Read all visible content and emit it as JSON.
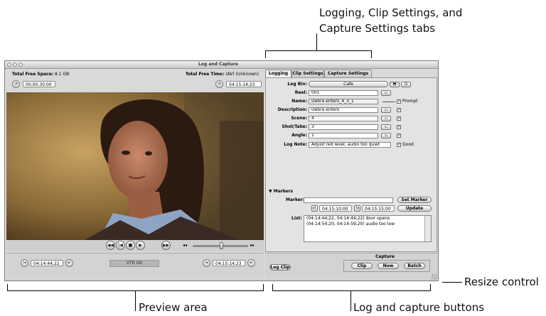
{
  "callouts": {
    "tabs_line1": "Logging, Clip Settings, and",
    "tabs_line2": "Capture Settings tabs",
    "resize": "Resize control",
    "preview": "Preview area",
    "log_capture": "Log and capture buttons"
  },
  "window": {
    "title": "Log and Capture",
    "total_free_space_label": "Total Free Space:",
    "total_free_space_value": "8.1 GB",
    "total_free_time_label": "Total Free Time:",
    "total_free_time_value": "(AV) (Unknown)",
    "duration_tc": "00:00:30;00",
    "current_tc": "04:15:14;23"
  },
  "transport": {
    "rewind": "◀◀",
    "prev": "|◀",
    "stop": "■",
    "play": "▶",
    "ffwd": "▶▶"
  },
  "bottom_left": {
    "in_tc": "04:14:44;22",
    "vtr_status": "VTR OK",
    "out_tc": "04:15:14;23"
  },
  "tabs": [
    "Logging",
    "Clip Settings",
    "Capture Settings"
  ],
  "logging": {
    "fields": [
      {
        "label": "Log Bin:",
        "value": "Cafe"
      },
      {
        "label": "Reel:",
        "value": "001"
      },
      {
        "label": "Name:",
        "value": "Debra enters_4_3_1"
      },
      {
        "label": "Description:",
        "value": "Debra enters"
      },
      {
        "label": "Scene:",
        "value": "4"
      },
      {
        "label": "Shot/Take:",
        "value": "3"
      },
      {
        "label": "Angle:",
        "value": "1"
      },
      {
        "label": "Log Note:",
        "value": "Adjust red level; audio too quiet"
      }
    ],
    "prompt_label": "Prompt",
    "good_label": "Good"
  },
  "markers": {
    "header": "Markers",
    "marker_label": "Marker:",
    "marker_value": "",
    "in_tc": "04:15:10;00",
    "out_tc": "04:15:15;00",
    "set_marker": "Set Marker",
    "update": "Update",
    "list_label": "List:",
    "list_items": [
      "(04:14:44;22, 04:14:44;22) door opens",
      "(04:14:54;20, 04:14:59;20) audio too low"
    ]
  },
  "capture": {
    "log_clip": "Log Clip",
    "group_label": "Capture",
    "clip": "Clip",
    "now": "Now",
    "batch": "Batch"
  }
}
